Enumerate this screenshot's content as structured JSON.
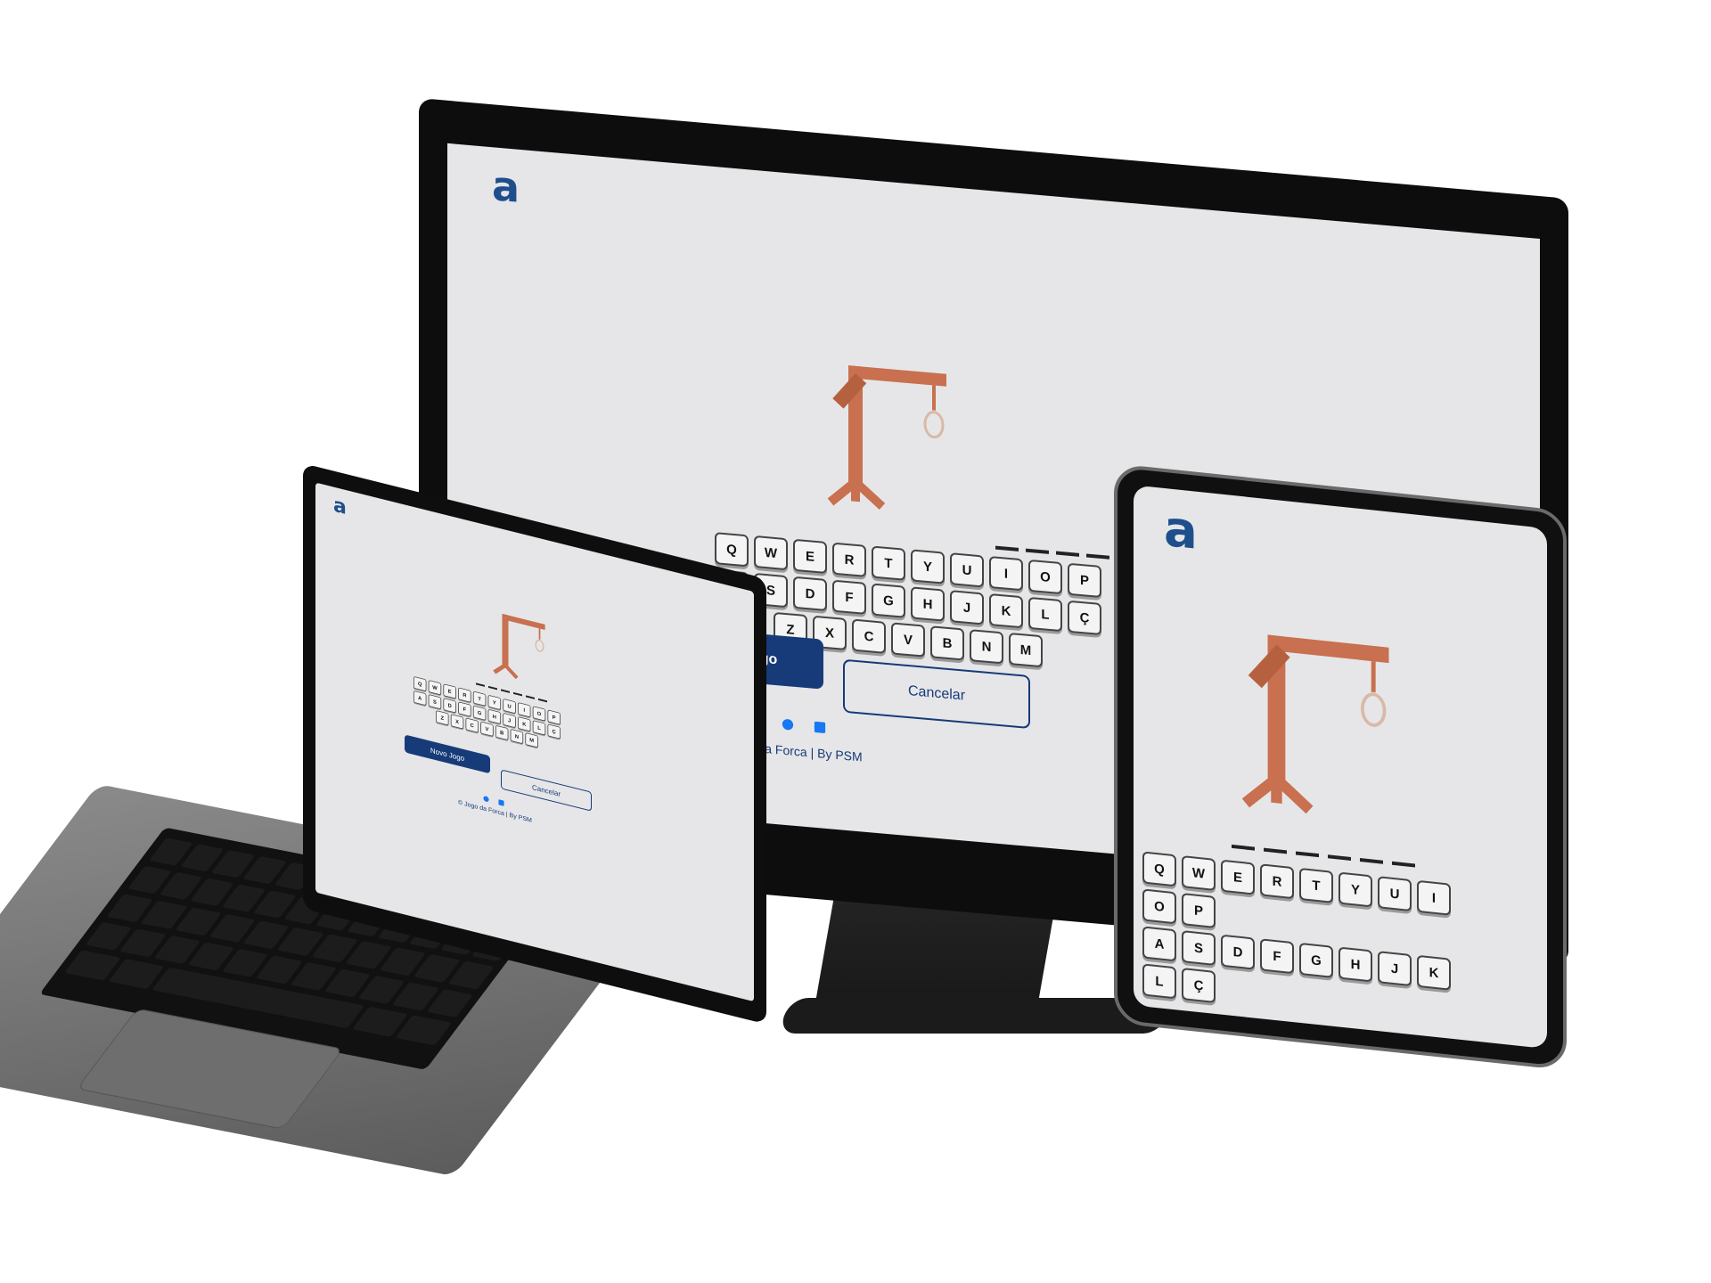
{
  "app": {
    "logo": "a",
    "word_blanks": 6,
    "keyboard_rows": [
      [
        "Q",
        "W",
        "E",
        "R",
        "T",
        "Y",
        "U",
        "I",
        "O",
        "P"
      ],
      [
        "A",
        "S",
        "D",
        "F",
        "G",
        "H",
        "J",
        "K",
        "L",
        "Ç"
      ],
      [
        "Z",
        "X",
        "C",
        "V",
        "B",
        "N",
        "M"
      ]
    ],
    "new_game_label": "Novo Jogo",
    "cancel_label": "Cancelar",
    "footer_text": "© Jogo da Forca | By PSM",
    "footer_icons": [
      "github-icon",
      "linkedin-icon"
    ]
  },
  "tablet_keyboard_rows": [
    [
      "Q",
      "W",
      "E",
      "R",
      "T",
      "Y",
      "U",
      "I"
    ],
    [
      "O",
      "P"
    ],
    [
      "A",
      "S",
      "D",
      "F",
      "G",
      "H",
      "J",
      "K"
    ],
    [
      "L",
      "Ç"
    ]
  ],
  "colors": {
    "screen_bg": "#e6e6e8",
    "accent": "#163b78",
    "logo": "#1f4e8c",
    "gallows": "#c8704f"
  }
}
